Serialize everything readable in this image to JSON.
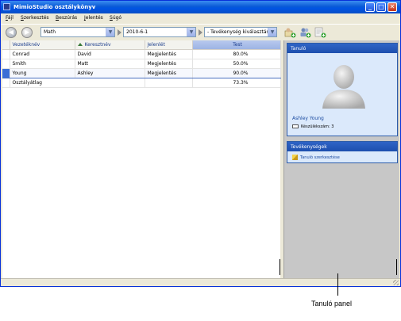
{
  "window": {
    "title": "MimioStudio osztálykönyv",
    "controls": {
      "minimize": "_",
      "maximize": "□",
      "close": "✕"
    }
  },
  "menu": [
    "Fájl",
    "Szerkesztés",
    "Beszúrás",
    "Jelentés",
    "Súgó"
  ],
  "toolbar": {
    "class_combo": "Math",
    "date_combo": "2010-6-1",
    "activity_combo": "- Tevékenység kiválasztása -",
    "icons": [
      "back-icon",
      "forward-icon",
      "add-student-icon",
      "add-group-icon",
      "add-activity-icon"
    ]
  },
  "grid": {
    "columns": [
      "Vezetéknév",
      "Keresztnév",
      "Jelenlét",
      "Test"
    ],
    "rows": [
      {
        "last": "Conrad",
        "first": "David",
        "attendance": "Megjelentés",
        "score": "80.0%"
      },
      {
        "last": "Smith",
        "first": "Matt",
        "attendance": "Megjelentés",
        "score": "50.0%"
      },
      {
        "last": "Young",
        "first": "Ashley",
        "attendance": "Megjelentés",
        "score": "90.0%"
      }
    ],
    "average": {
      "label": "Osztályátlag",
      "score": "73.3%"
    }
  },
  "panel": {
    "student_header": "Tanuló",
    "student_name": "Ashley Young",
    "device": "Készülékszám: 3",
    "activities_header": "Tevékenységek",
    "activity_item": "Tanuló szerkesztése"
  },
  "callout": "Tanuló panel",
  "colors": {
    "accent": "#2c5ba8",
    "selection": "#3b6fd6",
    "panel_bg": "#c7c7c7"
  }
}
